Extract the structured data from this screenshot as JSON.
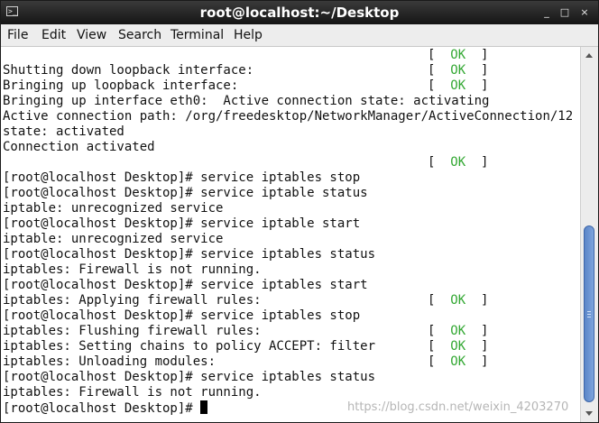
{
  "window": {
    "title": "root@localhost:~/Desktop",
    "icon": "terminal-icon",
    "controls": {
      "minimize": "_",
      "maximize": "□",
      "close": "×"
    }
  },
  "menu": [
    "File",
    "Edit",
    "View",
    "Search",
    "Terminal",
    "Help"
  ],
  "terminal": {
    "lines": [
      {
        "text": "",
        "status": "OK"
      },
      {
        "text": "Shutting down loopback interface:",
        "status": "OK"
      },
      {
        "text": "Bringing up loopback interface:",
        "status": "OK"
      },
      {
        "text": "Bringing up interface eth0:  Active connection state: activating",
        "status": ""
      },
      {
        "text": "Active connection path: /org/freedesktop/NetworkManager/ActiveConnection/12",
        "status": ""
      },
      {
        "text": "state: activated",
        "status": ""
      },
      {
        "text": "Connection activated",
        "status": ""
      },
      {
        "text": "",
        "status": "OK"
      },
      {
        "text": "[root@localhost Desktop]# service iptables stop",
        "status": ""
      },
      {
        "text": "[root@localhost Desktop]# service iptable status",
        "status": ""
      },
      {
        "text": "iptable: unrecognized service",
        "status": ""
      },
      {
        "text": "[root@localhost Desktop]# service iptable start",
        "status": ""
      },
      {
        "text": "iptable: unrecognized service",
        "status": ""
      },
      {
        "text": "[root@localhost Desktop]# service iptables status",
        "status": ""
      },
      {
        "text": "iptables: Firewall is not running.",
        "status": ""
      },
      {
        "text": "[root@localhost Desktop]# service iptables start",
        "status": ""
      },
      {
        "text": "iptables: Applying firewall rules:",
        "status": "OK"
      },
      {
        "text": "[root@localhost Desktop]# service iptables stop",
        "status": ""
      },
      {
        "text": "iptables: Flushing firewall rules:",
        "status": "OK"
      },
      {
        "text": "iptables: Setting chains to policy ACCEPT: filter",
        "status": "OK"
      },
      {
        "text": "iptables: Unloading modules:",
        "status": "OK"
      },
      {
        "text": "[root@localhost Desktop]# service iptables status",
        "status": ""
      },
      {
        "text": "iptables: Firewall is not running.",
        "status": ""
      }
    ],
    "prompt": "[root@localhost Desktop]# "
  },
  "watermark": "https://blog.csdn.net/weixin_4203270",
  "colors": {
    "ok": "#33a833",
    "scroll_thumb": "#6a94d2"
  }
}
